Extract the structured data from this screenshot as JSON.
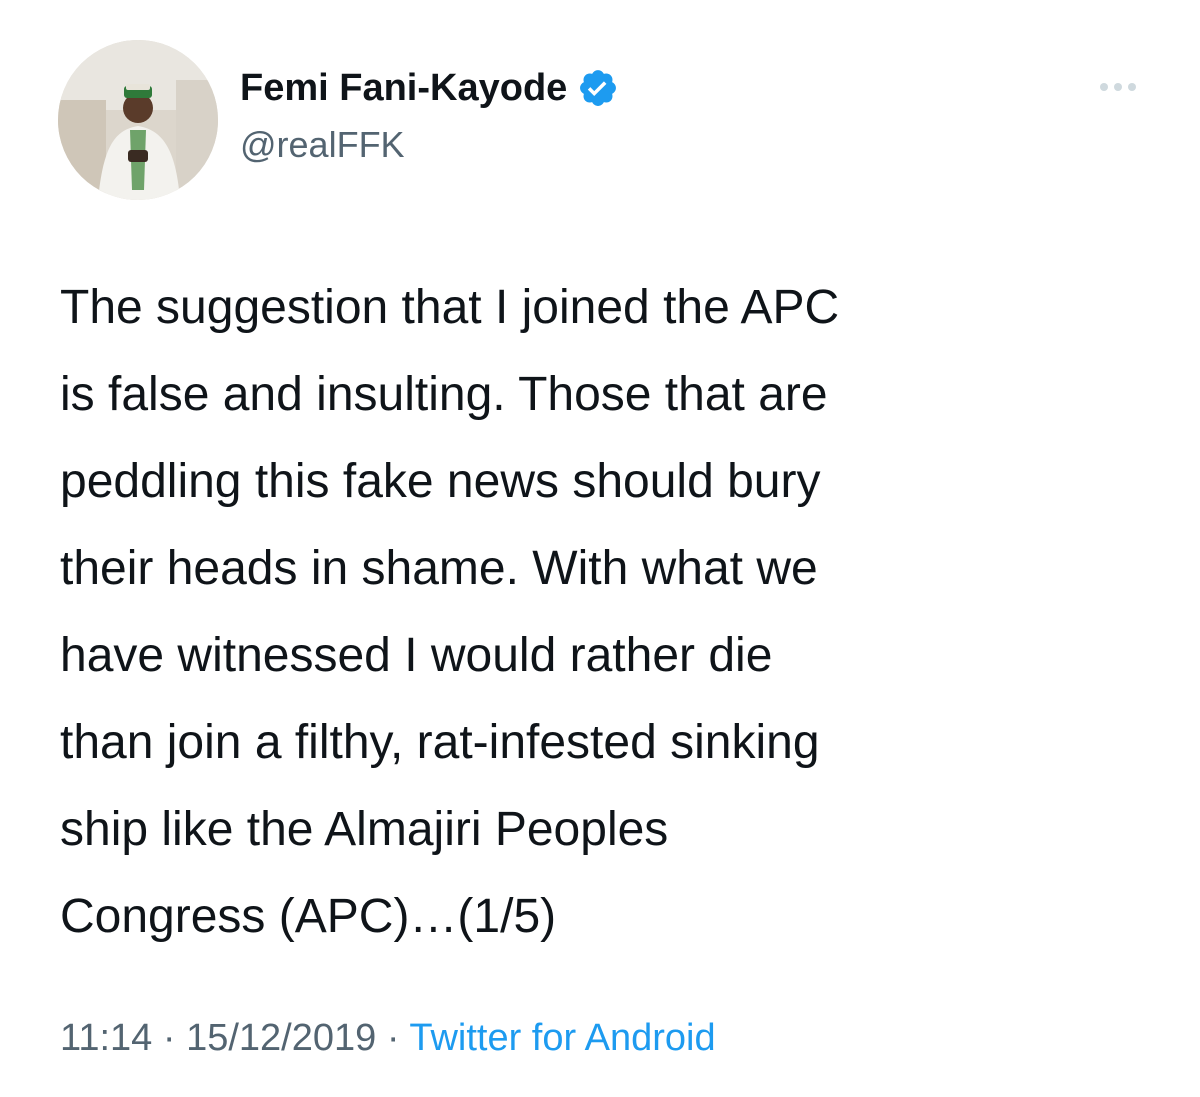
{
  "author": {
    "name": "Femi Fani-Kayode",
    "handle": "@realFFK",
    "verified": true,
    "avatar_icon": "profile-photo",
    "verified_icon": "verified-badge-icon"
  },
  "menu": {
    "icon": "more-options-icon"
  },
  "tweet": {
    "lines": [
      "The suggestion that I joined the APC",
      "is false and insulting. Those that are",
      "peddling this fake news should bury",
      "their heads in shame. With what we",
      "have witnessed I would rather die",
      "than join a filthy, rat-infested sinking",
      "ship like the Almajiri Peoples",
      "Congress (APC)…(1/5)"
    ]
  },
  "meta": {
    "time": "11:14",
    "separator": "·",
    "date": "15/12/2019",
    "source": "Twitter for Android"
  },
  "colors": {
    "text": "#0f1419",
    "secondary": "#536471",
    "accent": "#1d9bf0"
  }
}
